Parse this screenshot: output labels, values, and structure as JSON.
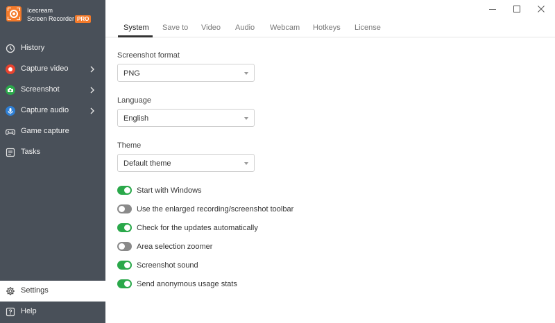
{
  "app": {
    "name_line1": "Icecream",
    "name_line2": "Screen Recorder",
    "badge": "PRO",
    "brand_color": "#f47a2a",
    "sidebar_color": "#495059"
  },
  "window_controls": {
    "minimize": "minimize-icon",
    "maximize": "maximize-icon",
    "close": "close-icon"
  },
  "sidebar": {
    "items": [
      {
        "label": "History",
        "icon": "clock-icon"
      },
      {
        "label": "Capture video",
        "icon": "record-icon",
        "icon_color": "#e8432f"
      },
      {
        "label": "Screenshot",
        "icon": "camera-icon",
        "icon_color": "#2aa84a"
      },
      {
        "label": "Capture audio",
        "icon": "microphone-icon",
        "icon_color": "#2f80d6"
      },
      {
        "label": "Game capture",
        "icon": "gamepad-icon"
      },
      {
        "label": "Tasks",
        "icon": "tasks-icon"
      }
    ],
    "bottom": [
      {
        "label": "Settings",
        "icon": "gear-icon"
      },
      {
        "label": "Help",
        "icon": "help-icon"
      }
    ]
  },
  "tabs": [
    "System",
    "Save to",
    "Video",
    "Audio",
    "Webcam",
    "Hotkeys",
    "License"
  ],
  "active_tab": "System",
  "settings": {
    "screenshot_format": {
      "label": "Screenshot format",
      "value": "PNG"
    },
    "language": {
      "label": "Language",
      "value": "English"
    },
    "theme": {
      "label": "Theme",
      "value": "Default theme"
    }
  },
  "toggles": [
    {
      "label": "Start with Windows",
      "on": true
    },
    {
      "label": "Use the enlarged recording/screenshot toolbar",
      "on": false
    },
    {
      "label": "Check for the updates automatically",
      "on": true
    },
    {
      "label": "Area selection zoomer",
      "on": false
    },
    {
      "label": "Screenshot sound",
      "on": true
    },
    {
      "label": "Send anonymous usage stats",
      "on": true
    }
  ],
  "toggle_colors": {
    "on": "#2aa84a",
    "off": "#8a8a8a"
  }
}
